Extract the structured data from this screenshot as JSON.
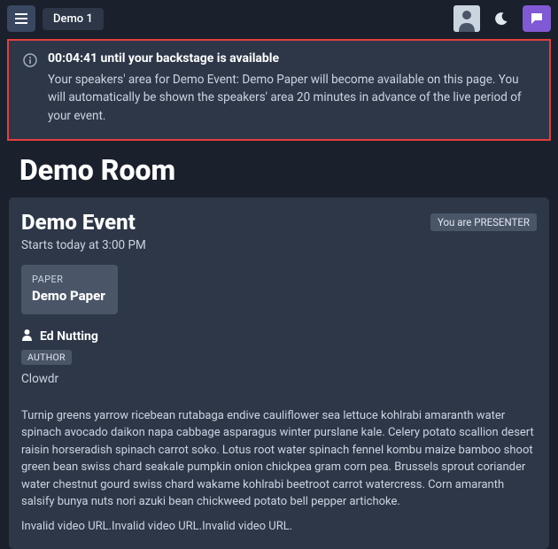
{
  "topbar": {
    "breadcrumb": "Demo 1"
  },
  "notice": {
    "title": "00:04:41 until your backstage is available",
    "body": "Your speakers' area for Demo Event: Demo Paper will become available on this page. You will automatically be shown the speakers' area 20 minutes in advance of the live period of your event."
  },
  "page": {
    "title": "Demo Room"
  },
  "event": {
    "title": "Demo Event",
    "starts": "Starts today at 3:00 PM",
    "roleBadge": "You are PRESENTER",
    "paperLabel": "PAPER",
    "paperTitle": "Demo Paper",
    "authorName": "Ed Nutting",
    "authorBadge": "AUTHOR",
    "affiliation": "Clowdr",
    "description": "Turnip greens yarrow ricebean rutabaga endive cauliflower sea lettuce kohlrabi amaranth water spinach avocado daikon napa cabbage asparagus winter purslane kale. Celery potato scallion desert raisin horseradish spinach carrot soko. Lotus root water spinach fennel kombu maize bamboo shoot green bean swiss chard seakale pumpkin onion chickpea gram corn pea. Brussels sprout coriander water chestnut gourd swiss chard wakame kohlrabi beetroot carrot watercress. Corn amaranth salsify bunya nuts nori azuki bean chickweed potato bell pepper artichoke.",
    "videoErrors": "Invalid video URL.Invalid video URL.Invalid video URL."
  }
}
